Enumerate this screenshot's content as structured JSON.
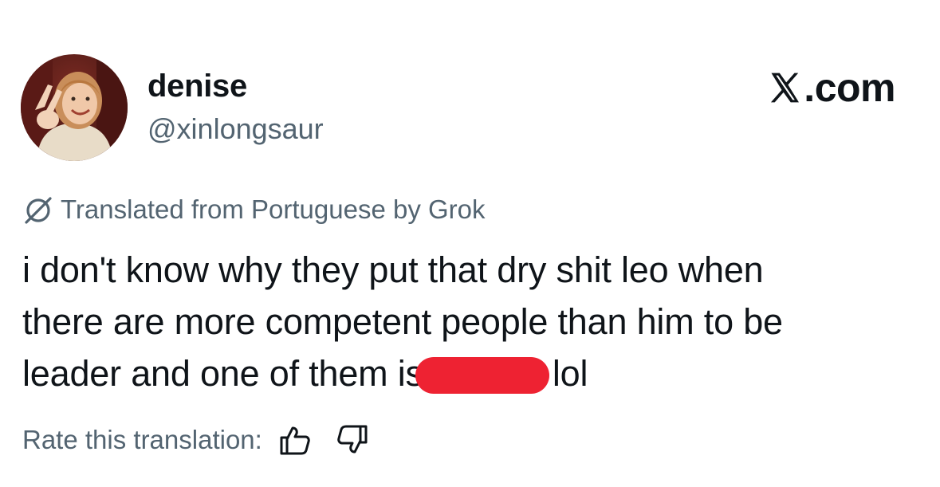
{
  "user": {
    "display_name": "denise",
    "handle": "@xinlongsaur",
    "avatar_icon": "profile-photo"
  },
  "brand": {
    "icon": "x-logo-icon",
    "label": ".com"
  },
  "translation": {
    "icon": "grok-icon",
    "label": "Translated from Portuguese by Grok"
  },
  "tweet": {
    "lines": [
      "i don't know why they put that dry shit leo when",
      "there are more competent people than him to be"
    ],
    "line3_before": "leader and one of them is",
    "line3_after": "lol",
    "redaction_color": "#ee2232"
  },
  "rating": {
    "label": "Rate this translation:",
    "thumbs_up_icon": "thumbs-up-icon",
    "thumbs_down_icon": "thumbs-down-icon"
  },
  "colors": {
    "text_primary": "#0f1419",
    "text_secondary": "#536471",
    "background": "#ffffff"
  }
}
